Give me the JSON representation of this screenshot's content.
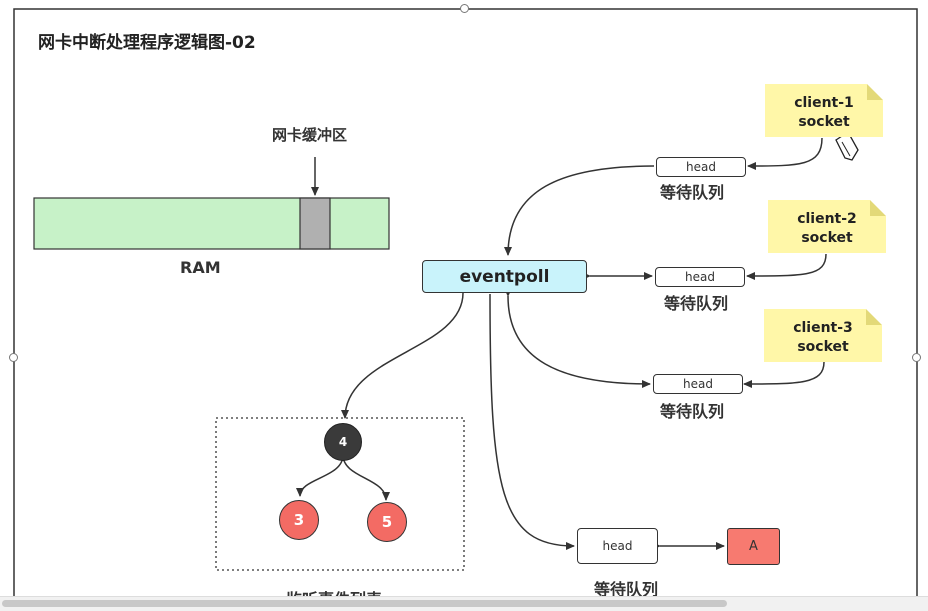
{
  "title": "网卡中断处理程序逻辑图-02",
  "buffer_label": "网卡缓冲区",
  "ram_label": "RAM",
  "eventpoll_label": "eventpoll",
  "queues": [
    {
      "head": "head",
      "label": "等待队列"
    },
    {
      "head": "head",
      "label": "等待队列"
    },
    {
      "head": "head",
      "label": "等待队列"
    },
    {
      "head": "head",
      "label": "等待队列"
    }
  ],
  "sockets": [
    {
      "line1": "client-1",
      "line2": "socket"
    },
    {
      "line1": "client-2",
      "line2": "socket"
    },
    {
      "line1": "client-3",
      "line2": "socket"
    }
  ],
  "tree": {
    "root": "4",
    "left": "3",
    "right": "5"
  },
  "listen_label": "监听事件列表",
  "ready_item": "A",
  "colors": {
    "ram_fill": "#c7f2c8",
    "buffer_fill": "#b0b0b0",
    "eventpoll_fill": "#c9f3fb",
    "note_fill": "#fff7a8",
    "root_node": "#3a3a3a",
    "child_node": "#f36b64",
    "ready_fill": "#f77a70"
  }
}
